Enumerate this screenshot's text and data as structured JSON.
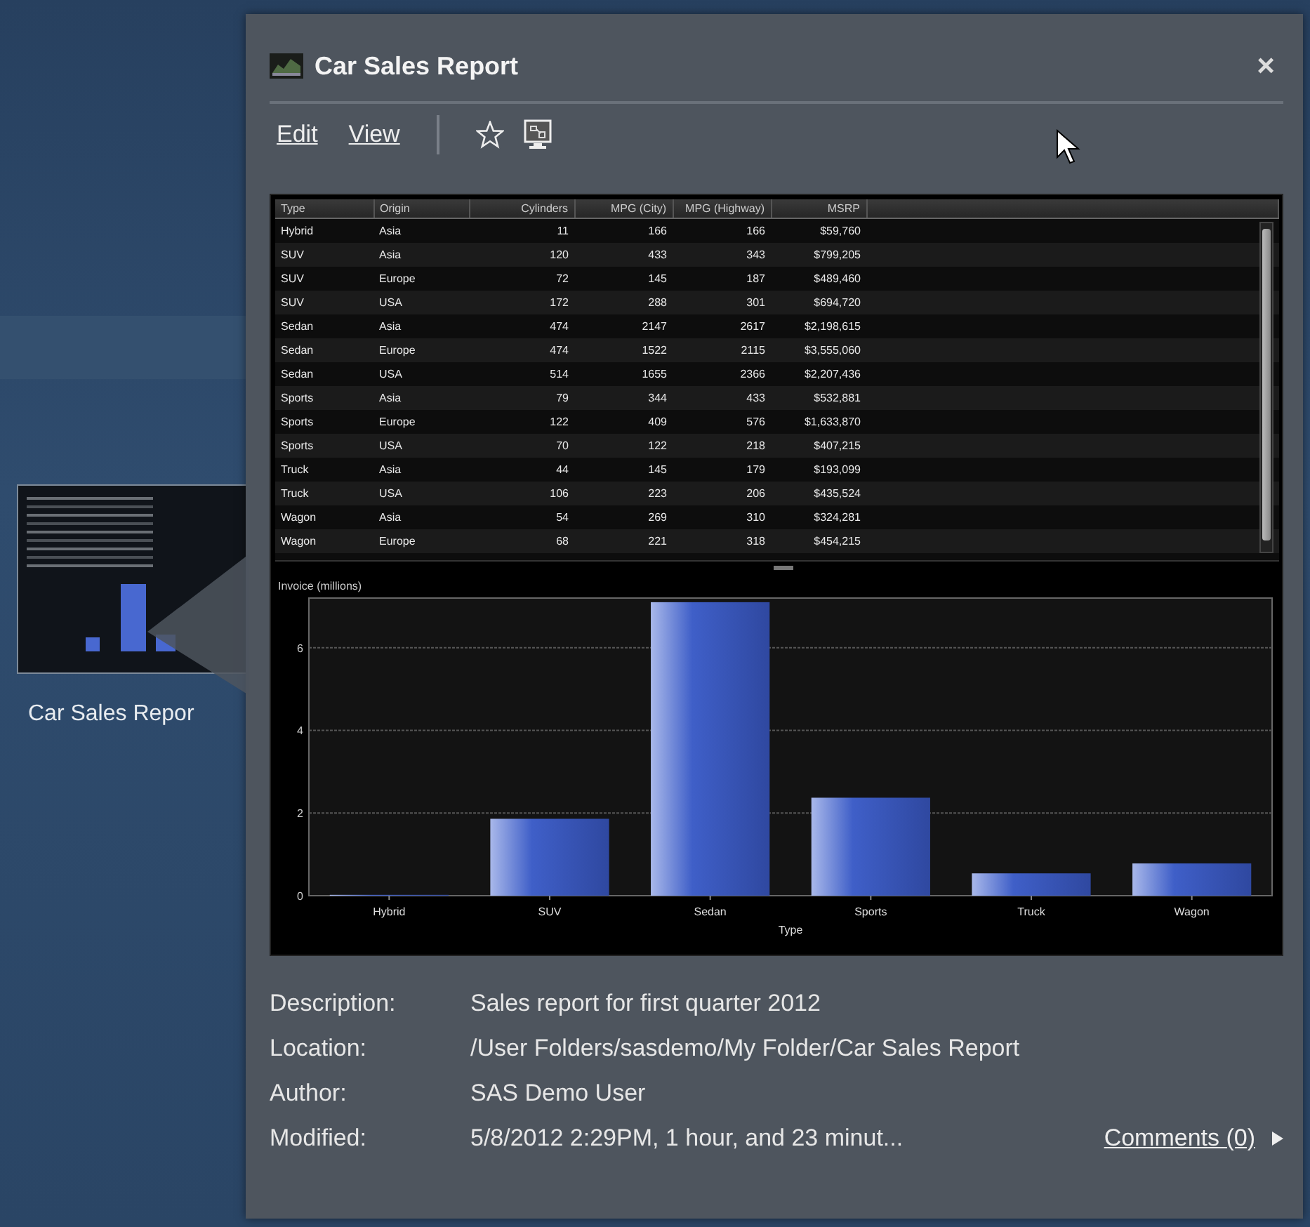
{
  "desktop": {
    "thumbnail": {
      "label": "Car Sales Repor"
    }
  },
  "panel": {
    "title": "Car Sales Report",
    "close": "×",
    "toolbar": {
      "links": [
        "Edit",
        "View"
      ]
    },
    "table": {
      "columns": [
        "Type",
        "Origin",
        "Cylinders",
        "MPG (City)",
        "MPG (Highway)",
        "MSRP"
      ],
      "rows": [
        [
          "Hybrid",
          "Asia",
          "11",
          "166",
          "166",
          "$59,760"
        ],
        [
          "SUV",
          "Asia",
          "120",
          "433",
          "343",
          "$799,205"
        ],
        [
          "SUV",
          "Europe",
          "72",
          "145",
          "187",
          "$489,460"
        ],
        [
          "SUV",
          "USA",
          "172",
          "288",
          "301",
          "$694,720"
        ],
        [
          "Sedan",
          "Asia",
          "474",
          "2147",
          "2617",
          "$2,198,615"
        ],
        [
          "Sedan",
          "Europe",
          "474",
          "1522",
          "2115",
          "$3,555,060"
        ],
        [
          "Sedan",
          "USA",
          "514",
          "1655",
          "2366",
          "$2,207,436"
        ],
        [
          "Sports",
          "Asia",
          "79",
          "344",
          "433",
          "$532,881"
        ],
        [
          "Sports",
          "Europe",
          "122",
          "409",
          "576",
          "$1,633,870"
        ],
        [
          "Sports",
          "USA",
          "70",
          "122",
          "218",
          "$407,215"
        ],
        [
          "Truck",
          "Asia",
          "44",
          "145",
          "179",
          "$193,099"
        ],
        [
          "Truck",
          "USA",
          "106",
          "223",
          "206",
          "$435,524"
        ],
        [
          "Wagon",
          "Asia",
          "54",
          "269",
          "310",
          "$324,281"
        ],
        [
          "Wagon",
          "Europe",
          "68",
          "221",
          "318",
          "$454,215"
        ]
      ]
    },
    "chart": {
      "chart_data": {
        "type": "bar",
        "ylabel": "Invoice (millions)",
        "xlabel": "Type",
        "categories": [
          "Hybrid",
          "SUV",
          "Sedan",
          "Sports",
          "Truck",
          "Wagon"
        ],
        "series": [
          {
            "color": "#3f5fc8",
            "values": [
              0.02,
              1.86,
              7.1,
              2.37,
              0.54,
              0.78
            ]
          }
        ],
        "ylim": [
          0,
          7.2
        ],
        "yticks": [
          0,
          2,
          4,
          6
        ],
        "grid": true
      }
    },
    "details": [
      {
        "label": "Description:",
        "value": "Sales report for first quarter 2012"
      },
      {
        "label": "Location:",
        "value": "/User Folders/sasdemo/My Folder/Car Sales Report"
      },
      {
        "label": "Author:",
        "value": "SAS Demo User"
      },
      {
        "label": "Modified:",
        "value": "5/8/2012 2:29PM, 1 hour, and 23 minut..."
      }
    ],
    "comments_link": "Comments (0)"
  }
}
